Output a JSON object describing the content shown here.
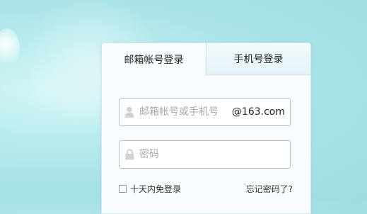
{
  "tabs": {
    "mail_login": "邮箱帐号登录",
    "phone_login": "手机号登录"
  },
  "form": {
    "account_placeholder": "邮箱帐号或手机号",
    "domain_suffix": "@163.com",
    "password_placeholder": "密码",
    "remember_label": "十天内免登录",
    "forgot_link": "忘记密码了?"
  },
  "icons": {
    "user": "user-icon",
    "lock": "lock-icon"
  },
  "colors": {
    "background": "#b4e9ec",
    "panel": "#f7fcfe",
    "icon_gray": "#d2d2d2"
  }
}
